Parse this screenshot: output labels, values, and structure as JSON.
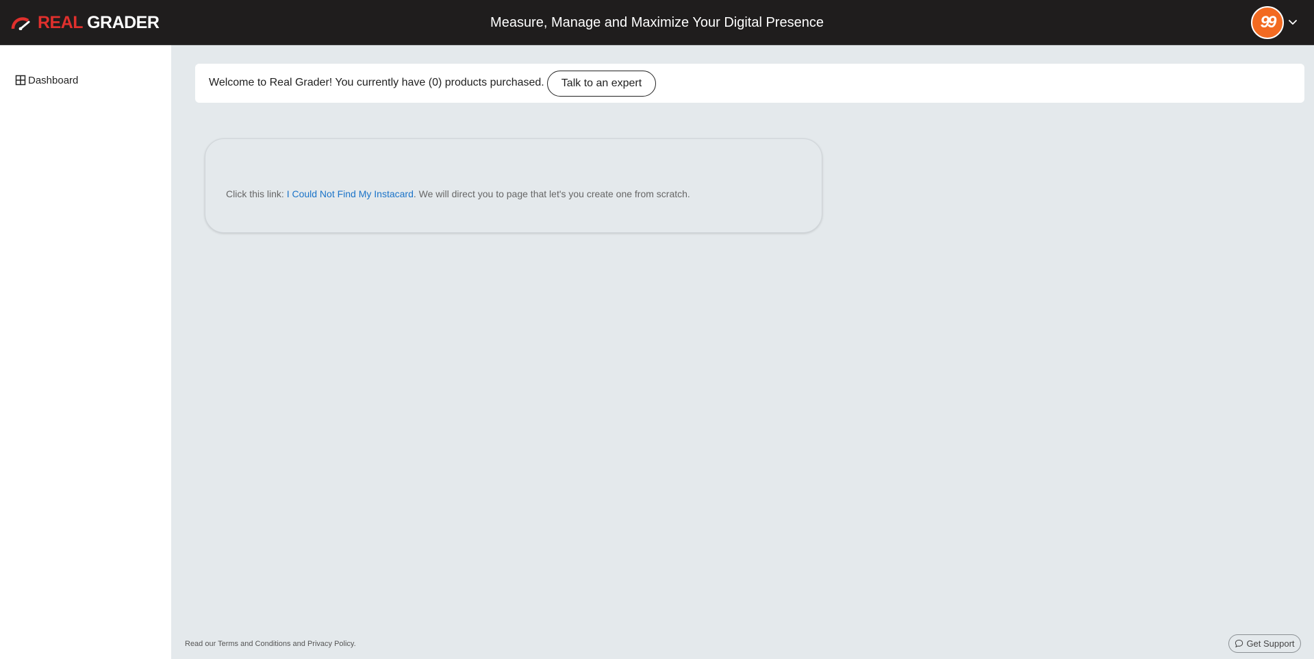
{
  "brand": {
    "name_part1": "REAL",
    "name_part2": "GRADER",
    "accent_color": "#e0302d"
  },
  "header": {
    "title": "Measure, Manage and Maximize Your Digital Presence",
    "avatar_text": "99",
    "avatar_color": "#f26a21"
  },
  "sidebar": {
    "items": [
      {
        "label": "Dashboard",
        "icon": "grid-icon"
      }
    ]
  },
  "welcome": {
    "text": "Welcome to Real Grader! You currently have (0) products purchased.",
    "button_label": "Talk to an expert"
  },
  "info": {
    "prefix": "Click this link: ",
    "link_text": "I Could Not Find My Instacard",
    "suffix": ". We will direct you to page that let's you create one from scratch."
  },
  "footer": {
    "prefix": "Read our ",
    "terms_link": "Terms and Conditions",
    "middle": " and ",
    "privacy_link": "Privacy Policy",
    "suffix": ".",
    "support_label": "Get Support"
  }
}
